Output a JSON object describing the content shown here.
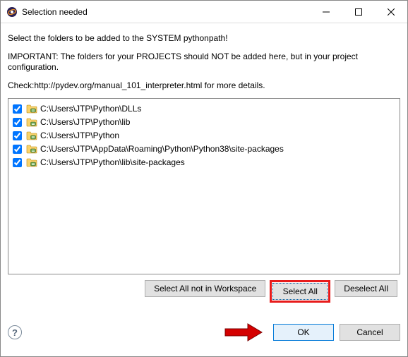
{
  "window": {
    "title": "Selection needed"
  },
  "messages": {
    "line1": "Select the folders to be added to the SYSTEM pythonpath!",
    "line2": "IMPORTANT: The folders for your PROJECTS should NOT be added here, but in your project configuration.",
    "line3": "Check:http://pydev.org/manual_101_interpreter.html for more details."
  },
  "items": [
    {
      "checked": true,
      "path": "C:\\Users\\JTP\\Python\\DLLs"
    },
    {
      "checked": true,
      "path": "C:\\Users\\JTP\\Python\\lib"
    },
    {
      "checked": true,
      "path": "C:\\Users\\JTP\\Python"
    },
    {
      "checked": true,
      "path": "C:\\Users\\JTP\\AppData\\Roaming\\Python\\Python38\\site-packages"
    },
    {
      "checked": true,
      "path": "C:\\Users\\JTP\\Python\\lib\\site-packages"
    }
  ],
  "buttons": {
    "select_all_not_in_workspace": "Select All not in Workspace",
    "select_all": "Select All",
    "deselect_all": "Deselect All",
    "ok": "OK",
    "cancel": "Cancel"
  }
}
